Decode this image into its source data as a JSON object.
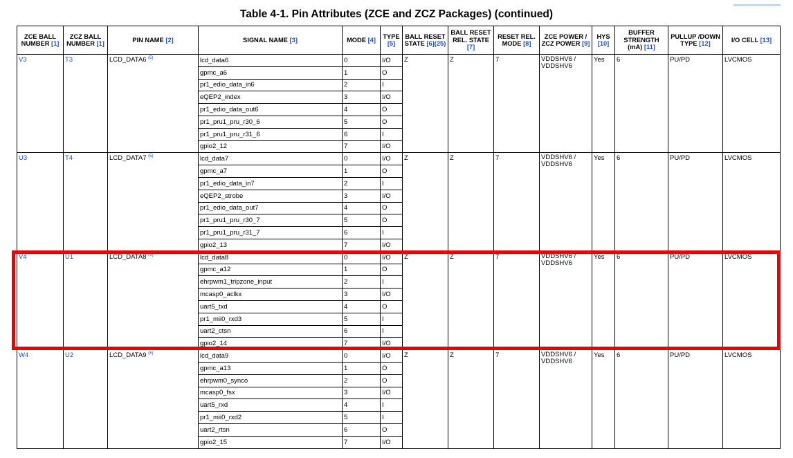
{
  "title": "Table 4-1. Pin Attributes (ZCE and ZCZ Packages) (continued)",
  "headers": [
    {
      "text": "ZCE BALL NUMBER",
      "ref": "[1]"
    },
    {
      "text": "ZCZ BALL NUMBER",
      "ref": "[1]"
    },
    {
      "text": "PIN NAME",
      "ref": "[2]"
    },
    {
      "text": "SIGNAL NAME",
      "ref": "[3]"
    },
    {
      "text": "MODE",
      "ref": "[4]"
    },
    {
      "text": "TYPE",
      "ref": "[5]"
    },
    {
      "text": "BALL RESET STATE",
      "ref": "[6](25)"
    },
    {
      "text": "BALL RESET REL. STATE",
      "ref": "[7]"
    },
    {
      "text": "RESET REL. MODE",
      "ref": "[8]"
    },
    {
      "text": "ZCE POWER / ZCZ POWER",
      "ref": "[9]"
    },
    {
      "text": "HYS",
      "ref": "[10]"
    },
    {
      "text": "BUFFER STRENGTH (mA)",
      "ref": "[11]"
    },
    {
      "text": "PULLUP /DOWN TYPE",
      "ref": "[12]"
    },
    {
      "text": "I/O CELL",
      "ref": "[13]"
    }
  ],
  "pins": [
    {
      "zce": "V3",
      "zcz": "T3",
      "pin_name": "LCD_DATA6",
      "pin_sup": "(5)",
      "reset_state": "Z",
      "reset_rel_state": "Z",
      "reset_rel_mode": "7",
      "power": "VDDSHV6 / VDDSHV6",
      "hys": "Yes",
      "buffer": "6",
      "pull": "PU/PD",
      "io_cell": "LVCMOS",
      "signals": [
        {
          "name": "lcd_data6",
          "mode": "0",
          "type": "I/O"
        },
        {
          "name": "gpmc_a6",
          "mode": "1",
          "type": "O"
        },
        {
          "name": "pr1_edio_data_in6",
          "mode": "2",
          "type": "I"
        },
        {
          "name": "eQEP2_index",
          "mode": "3",
          "type": "I/O"
        },
        {
          "name": "pr1_edio_data_out6",
          "mode": "4",
          "type": "O"
        },
        {
          "name": "pr1_pru1_pru_r30_6",
          "mode": "5",
          "type": "O"
        },
        {
          "name": "pr1_pru1_pru_r31_6",
          "mode": "6",
          "type": "I"
        },
        {
          "name": "gpio2_12",
          "mode": "7",
          "type": "I/O"
        }
      ]
    },
    {
      "zce": "U3",
      "zcz": "T4",
      "pin_name": "LCD_DATA7",
      "pin_sup": "(5)",
      "reset_state": "Z",
      "reset_rel_state": "Z",
      "reset_rel_mode": "7",
      "power": "VDDSHV6 / VDDSHV6",
      "hys": "Yes",
      "buffer": "6",
      "pull": "PU/PD",
      "io_cell": "LVCMOS",
      "signals": [
        {
          "name": "lcd_data7",
          "mode": "0",
          "type": "I/O"
        },
        {
          "name": "gpmc_a7",
          "mode": "1",
          "type": "O"
        },
        {
          "name": "pr1_edio_data_in7",
          "mode": "2",
          "type": "I"
        },
        {
          "name": "eQEP2_strobe",
          "mode": "3",
          "type": "I/O"
        },
        {
          "name": "pr1_edio_data_out7",
          "mode": "4",
          "type": "O"
        },
        {
          "name": "pr1_pru1_pru_r30_7",
          "mode": "5",
          "type": "O"
        },
        {
          "name": "pr1_pru1_pru_r31_7",
          "mode": "6",
          "type": "I"
        },
        {
          "name": "gpio2_13",
          "mode": "7",
          "type": "I/O"
        }
      ]
    },
    {
      "zce": "V4",
      "zcz": "U1",
      "pin_name": "LCD_DATA8",
      "pin_sup": "(5)",
      "reset_state": "Z",
      "reset_rel_state": "Z",
      "reset_rel_mode": "7",
      "power": "VDDSHV6 / VDDSHV6",
      "hys": "Yes",
      "buffer": "6",
      "pull": "PU/PD",
      "io_cell": "LVCMOS",
      "signals": [
        {
          "name": "lcd_data8",
          "mode": "0",
          "type": "I/O"
        },
        {
          "name": "gpmc_a12",
          "mode": "1",
          "type": "O"
        },
        {
          "name": "ehrpwm1_tripzone_input",
          "mode": "2",
          "type": "I"
        },
        {
          "name": "mcasp0_aclkx",
          "mode": "3",
          "type": "I/O"
        },
        {
          "name": "uart5_txd",
          "mode": "4",
          "type": "O"
        },
        {
          "name": "pr1_mii0_rxd3",
          "mode": "5",
          "type": "I"
        },
        {
          "name": "uart2_ctsn",
          "mode": "6",
          "type": "I"
        },
        {
          "name": "gpio2_14",
          "mode": "7",
          "type": "I/O"
        }
      ]
    },
    {
      "zce": "W4",
      "zcz": "U2",
      "pin_name": "LCD_DATA9",
      "pin_sup": "(5)",
      "reset_state": "Z",
      "reset_rel_state": "Z",
      "reset_rel_mode": "7",
      "power": "VDDSHV6 / VDDSHV6",
      "hys": "Yes",
      "buffer": "6",
      "pull": "PU/PD",
      "io_cell": "LVCMOS",
      "signals": [
        {
          "name": "lcd_data9",
          "mode": "0",
          "type": "I/O"
        },
        {
          "name": "gpmc_a13",
          "mode": "1",
          "type": "O"
        },
        {
          "name": "ehrpwm0_synco",
          "mode": "2",
          "type": "O"
        },
        {
          "name": "mcasp0_fsx",
          "mode": "3",
          "type": "I/O"
        },
        {
          "name": "uart5_rxd",
          "mode": "4",
          "type": "I"
        },
        {
          "name": "pr1_mii0_rxd2",
          "mode": "5",
          "type": "I"
        },
        {
          "name": "uart2_rtsn",
          "mode": "6",
          "type": "O"
        },
        {
          "name": "gpio2_15",
          "mode": "7",
          "type": "I/O"
        }
      ]
    }
  ],
  "colors": {
    "link": "#1a4fd6",
    "highlight": "#ee0000"
  }
}
